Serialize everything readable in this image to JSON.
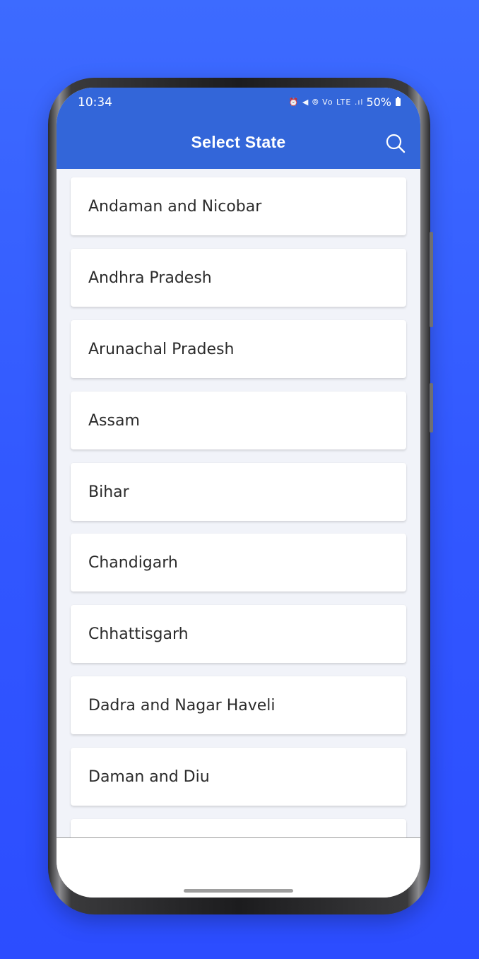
{
  "status_bar": {
    "time": "10:34",
    "icons": "⏰ ◀ ⦾ Vo LTE .ıl",
    "battery": "50%"
  },
  "header": {
    "title": "Select State",
    "search_icon": "search-icon"
  },
  "states": [
    "Andaman and Nicobar",
    "Andhra Pradesh",
    "Arunachal Pradesh",
    "Assam",
    "Bihar",
    "Chandigarh",
    "Chhattisgarh",
    "Dadra and Nagar Haveli",
    "Daman and Diu",
    ""
  ],
  "colors": {
    "appbar": "#3366d9",
    "background": "#3258ff",
    "list_background": "#f1f3f9"
  }
}
